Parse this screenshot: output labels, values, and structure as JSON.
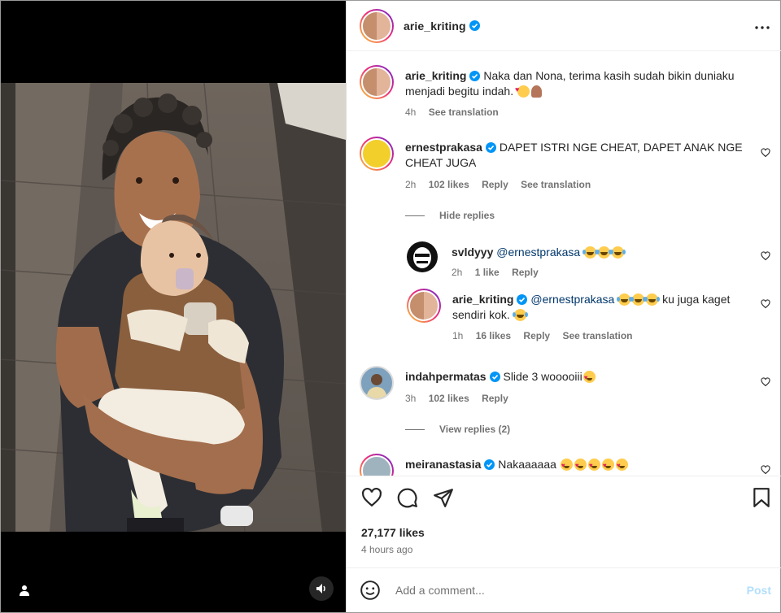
{
  "post": {
    "author": "arie_kriting",
    "verified": true,
    "likes": "27,177 likes",
    "posted_ago": "4 hours ago"
  },
  "caption": {
    "user": "arie_kriting",
    "text": "Naka dan Nona, terima kasih sudah bikin duniaku menjadi begitu indah.",
    "time": "4h",
    "translate": "See translation"
  },
  "comments": [
    {
      "user": "ernestprakasa",
      "text": "DAPET ISTRI NGE CHEAT, DAPET ANAK NGE CHEAT JUGA",
      "time": "2h",
      "likes": "102 likes",
      "reply": "Reply",
      "translate": "See translation",
      "replies_toggle": "Hide replies",
      "replies": [
        {
          "user": "svldyyy",
          "mention": "@ernestprakasa",
          "text": "",
          "time": "2h",
          "likes": "1 like",
          "reply": "Reply"
        },
        {
          "user": "arie_kriting",
          "mention": "@ernestprakasa",
          "text": "ku juga kaget sendiri kok.",
          "time": "1h",
          "likes": "16 likes",
          "reply": "Reply",
          "translate": "See translation"
        }
      ]
    },
    {
      "user": "indahpermatas",
      "text": "Slide 3 wooooiii",
      "time": "3h",
      "likes": "102 likes",
      "reply": "Reply",
      "replies_toggle": "View replies (2)"
    },
    {
      "user": "meiranastasia",
      "text": "Nakaaaaaa"
    }
  ],
  "composer": {
    "placeholder": "Add a comment...",
    "post_label": "Post"
  },
  "icons": {
    "header_more": "more-horizontal-icon",
    "like": "heart-icon",
    "comment": "comment-icon",
    "share": "send-icon",
    "save": "bookmark-icon",
    "emoji": "smiley-icon",
    "media_user": "user-tag-icon",
    "media_sound": "sound-on-icon",
    "verified": "verified-badge-icon"
  },
  "colors": {
    "verified_blue": "#0095f6",
    "text": "#262626",
    "secondary": "#737373",
    "mention": "#00376b",
    "post_disabled": "#b2dffc"
  }
}
